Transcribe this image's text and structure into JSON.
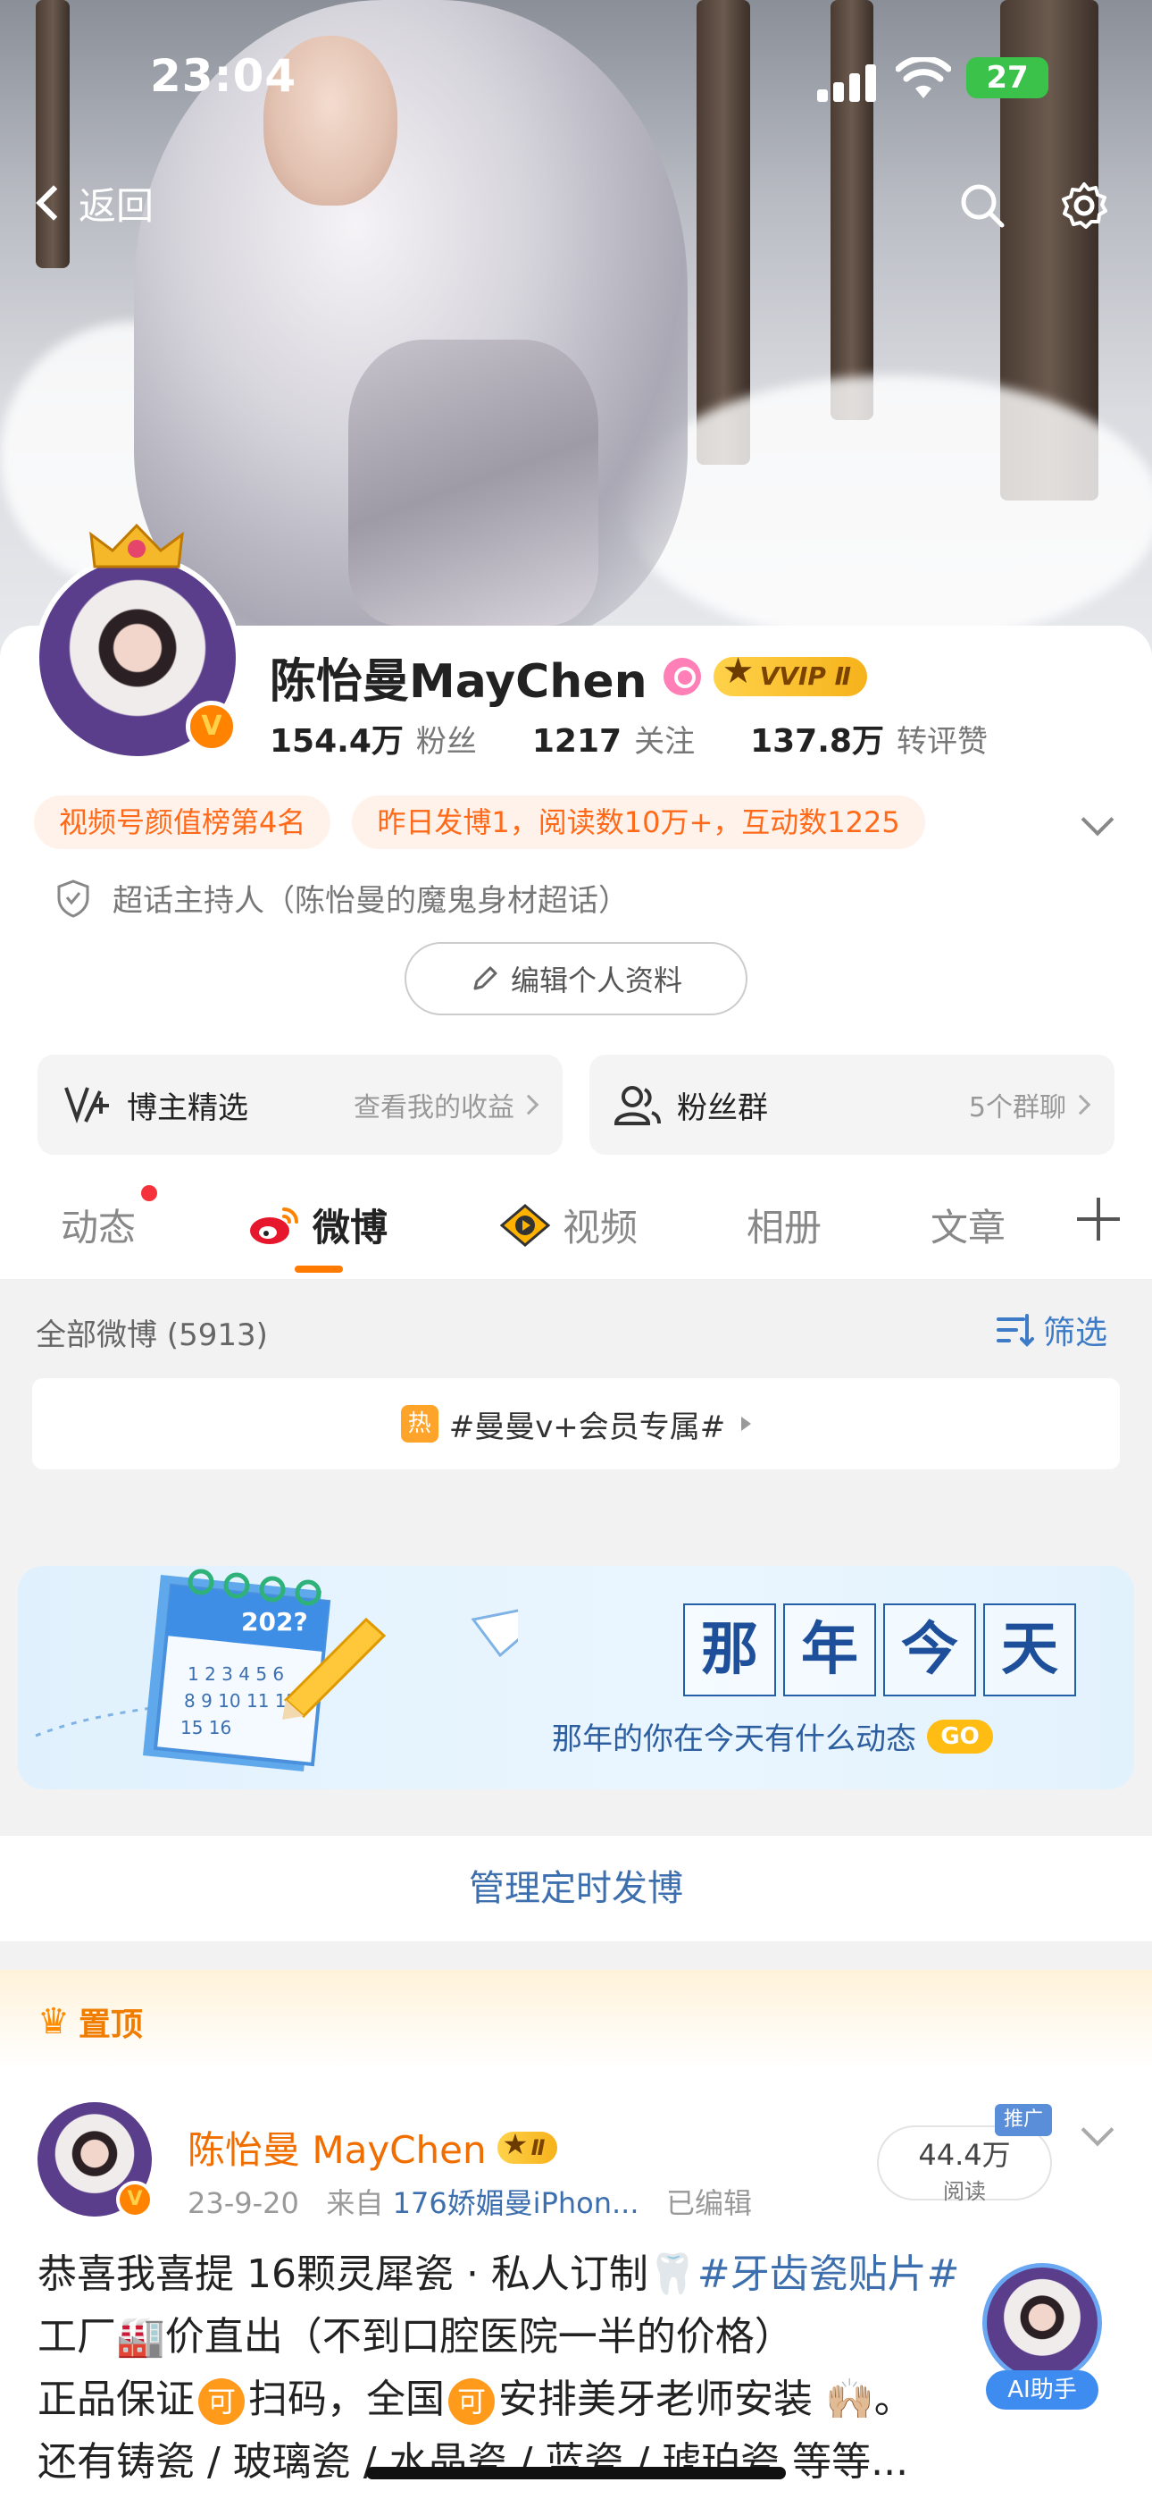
{
  "status_bar": {
    "time": "23:04",
    "battery": "27"
  },
  "nav": {
    "back_label": "返回"
  },
  "profile": {
    "name": "陈怡曼MayChen",
    "vip_label": "VVIP Ⅱ",
    "verified_badge": "V",
    "stats": [
      {
        "value": "154.4万",
        "label": "粉丝"
      },
      {
        "value": "1217",
        "label": "关注"
      },
      {
        "value": "137.8万",
        "label": "转评赞"
      }
    ],
    "tags": [
      "视频号颜值榜第4名",
      "昨日发博1，阅读数10万+，互动数1225"
    ],
    "host_text": "超话主持人（陈怡曼的魔鬼身材超话）",
    "edit_label": "编辑个人资料"
  },
  "quick_cards": {
    "picks": {
      "title": "博主精选",
      "sub": "查看我的收益"
    },
    "fans": {
      "title": "粉丝群",
      "sub": "5个群聊"
    }
  },
  "tabs": [
    "动态",
    "微博",
    "视频",
    "相册",
    "文章"
  ],
  "feed": {
    "count_label": "全部微博 (5913)",
    "filter_label": "筛选",
    "hot_badge": "热",
    "hot_topic": "#曼曼v+会员专属#",
    "memory_title": [
      "那",
      "年",
      "今",
      "天"
    ],
    "memory_sub": "那年的你在今天有什么动态",
    "memory_go": "GO",
    "calendar_year": "202?",
    "manage_label": "管理定时发博"
  },
  "post": {
    "pinned_label": "置顶",
    "author": "陈怡曼 MayChen",
    "vip_label": "Ⅱ",
    "date": "23-9-20",
    "source_prefix": "来自",
    "source": "176娇媚曼iPhon...",
    "edited": "已编辑",
    "reads_value": "44.4万",
    "reads_label": "阅读",
    "promo_label": "推广",
    "line1_text": "恭喜我喜提 16颗灵犀瓷 · 私人订制🦷",
    "line1_topic": "#牙齿瓷贴片#",
    "line2": "工厂🏭价直出（不到口腔医院一半的价格）",
    "line3_a": "正品保证",
    "line3_b": "扫码，全国",
    "line3_c": "安排美牙老师安装 🙌🏼。",
    "coin": "可",
    "line4": "还有铸瓷 / 玻璃瓷 / 水晶瓷 / 蓝瓷 / 琥珀瓷 等等..."
  },
  "ai_helper_label": "AI助手"
}
